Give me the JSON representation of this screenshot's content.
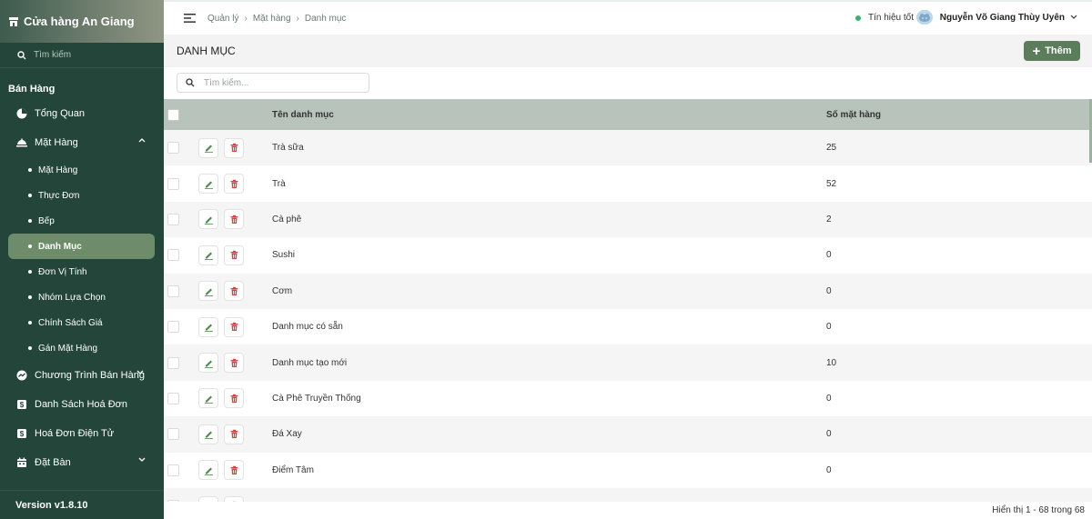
{
  "store": {
    "name": "Cửa hàng An Giang"
  },
  "sidebar": {
    "search_placeholder": "Tìm kiếm",
    "section": "Bán Hàng",
    "items": {
      "overview": "Tổng Quan",
      "products": "Mặt Hàng",
      "sales_program": "Chương Trình Bán Hàng",
      "invoices": "Danh Sách Hoá Đơn",
      "e_invoice": "Hoá Đơn Điện Tử",
      "booking": "Đặt Bàn"
    },
    "sub_items": [
      "Mặt Hàng",
      "Thực Đơn",
      "Bếp",
      "Danh Mục",
      "Đơn Vị Tính",
      "Nhóm Lựa Chọn",
      "Chính Sách Giá",
      "Gán Mặt Hàng"
    ],
    "active_sub": "Danh Mục",
    "version": "Version v1.8.10"
  },
  "topbar": {
    "breadcrumb": [
      "Quản lý",
      "Mặt hàng",
      "Danh mục"
    ],
    "signal": "Tín hiệu tốt",
    "user": "Nguyễn Võ Giang Thùy Uyên"
  },
  "page": {
    "title": "DANH MỤC",
    "add_label": "Thêm",
    "search_placeholder": "Tìm kiếm..."
  },
  "table": {
    "columns": {
      "name": "Tên danh mục",
      "count": "Số mặt hàng"
    },
    "rows": [
      {
        "name": "Trà sữa",
        "count": "25"
      },
      {
        "name": "Trà",
        "count": "52"
      },
      {
        "name": "Cà phê",
        "count": "2"
      },
      {
        "name": "Sushi",
        "count": "0"
      },
      {
        "name": "Cơm",
        "count": "0"
      },
      {
        "name": "Danh mục có sẵn",
        "count": "0"
      },
      {
        "name": "Danh mục tạo mới",
        "count": "10"
      },
      {
        "name": "Cà Phê Truyền Thống",
        "count": "0"
      },
      {
        "name": "Đá Xay",
        "count": "0"
      },
      {
        "name": "Điểm Tâm",
        "count": "0"
      },
      {
        "name": "",
        "count": ""
      }
    ]
  },
  "footer": {
    "summary": "Hiển thị 1 - 68 trong 68"
  },
  "colors": {
    "sidebar": "#24463a",
    "accent": "#5c7d5c",
    "active": "#6e8c6a",
    "header_row": "#b8c3bc",
    "edit": "#4f8a4f",
    "delete": "#d64545"
  }
}
